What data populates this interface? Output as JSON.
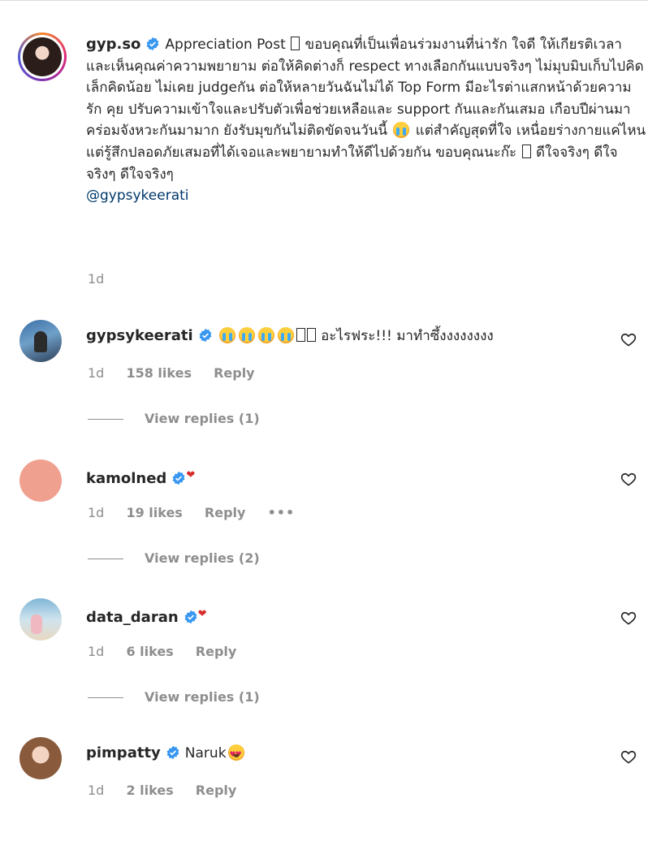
{
  "post": {
    "username": "gyp.so",
    "text": "Appreciation Post",
    "text_after_box": "ขอบคุณที่เป็นเพื่อนร่วมงานที่น่ารัก ใจดี ให้เกียรติเวลาและเห็นคุณค่าความพยายาม ต่อให้คิดต่างก็ respect ทางเลือกกันแบบจริงๆ ไม่มุบมิบเก็บไปคิดเล็กคิดน้อย ไม่เคย judgeกัน ต่อให้หลายวันฉันไม่ได้ Top Form มีอะไรต่าแสกหน้าด้วยความรัก คุย ปรับความเข้าใจและปรับตัวเพื่อช่วยเหลือและ support กันและกันเสมอ เกือบปีผ่านมา คร่อมจังหวะกันมามาก ยังรับมุขกันไม่ติดขัดจนวันนี้",
    "text_after_emoji": "แต่สำคัญสุดที่ใจ เหนื่อยร่างกายแค่ไหน แต่รู้สึกปลอดภัยเสมอที่ได้เจอและพยายามทำให้ดีไปด้วยกัน ขอบคุณนะก๊ะ",
    "text_end": "ดีใจจริงๆ ดีใจจริงๆ ดีใจจริงๆ",
    "mention": "@gypsykeerati",
    "time": "1d"
  },
  "comments": [
    {
      "username": "gypsykeerati",
      "text": "อะไรฟระ!!! มาทำซึ้งงงงงงงง",
      "time": "1d",
      "likes": "158 likes",
      "reply": "Reply",
      "view_replies": "View replies (1)"
    },
    {
      "username": "kamolned",
      "text": "",
      "time": "1d",
      "likes": "19 likes",
      "reply": "Reply",
      "more": "•••",
      "view_replies": "View replies (2)"
    },
    {
      "username": "data_daran",
      "text": "",
      "time": "1d",
      "likes": "6 likes",
      "reply": "Reply",
      "view_replies": "View replies (1)"
    },
    {
      "username": "pimpatty",
      "text": "Naruk",
      "time": "1d",
      "likes": "2 likes",
      "reply": "Reply"
    }
  ],
  "colors": {
    "verified": "#3897f0",
    "muted": "#8e8e8e",
    "link": "#00376b",
    "text": "#262626"
  }
}
